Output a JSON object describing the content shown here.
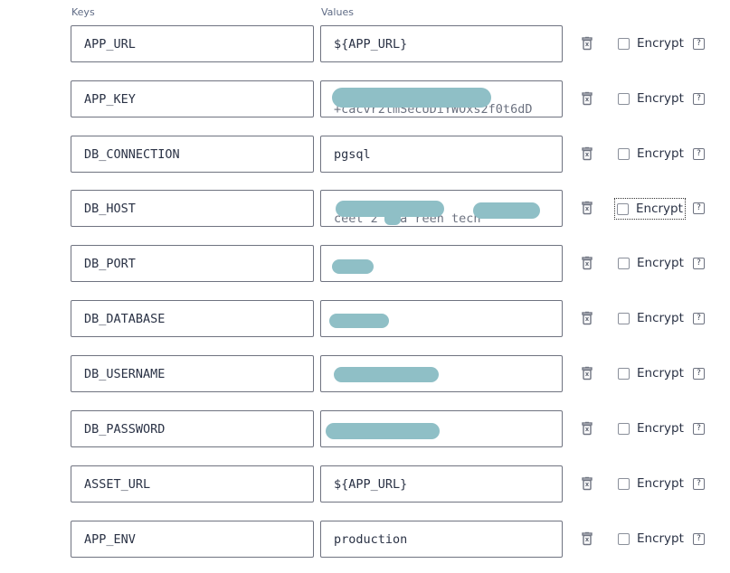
{
  "columns": {
    "keys": "Keys",
    "values": "Values"
  },
  "encrypt_label": "Encrypt",
  "help_glyph": "?",
  "rows": [
    {
      "key": "APP_URL",
      "value": "${APP_URL}",
      "value_peek": "",
      "redacted": false,
      "encrypt_checked": false
    },
    {
      "key": "APP_KEY",
      "value": "",
      "value_peek": "+cacvr2tmSecUDiYWOxs2f0t6dD",
      "redacted": true,
      "encrypt_checked": false
    },
    {
      "key": "DB_CONNECTION",
      "value": "pgsql",
      "value_peek": "",
      "redacted": false,
      "encrypt_checked": false
    },
    {
      "key": "DB_HOST",
      "value": "",
      "value_peek": "ceet 2 ..a reen tech",
      "redacted": true,
      "encrypt_checked": false
    },
    {
      "key": "DB_PORT",
      "value": "",
      "value_peek": "",
      "redacted": true,
      "encrypt_checked": false
    },
    {
      "key": "DB_DATABASE",
      "value": "",
      "value_peek": "",
      "redacted": true,
      "encrypt_checked": false
    },
    {
      "key": "DB_USERNAME",
      "value": "",
      "value_peek": "",
      "redacted": true,
      "encrypt_checked": false
    },
    {
      "key": "DB_PASSWORD",
      "value": "",
      "value_peek": "",
      "redacted": true,
      "encrypt_checked": false
    },
    {
      "key": "ASSET_URL",
      "value": "${APP_URL}",
      "value_peek": "",
      "redacted": false,
      "encrypt_checked": false
    },
    {
      "key": "APP_ENV",
      "value": "production",
      "value_peek": "",
      "redacted": false,
      "encrypt_checked": false
    }
  ]
}
